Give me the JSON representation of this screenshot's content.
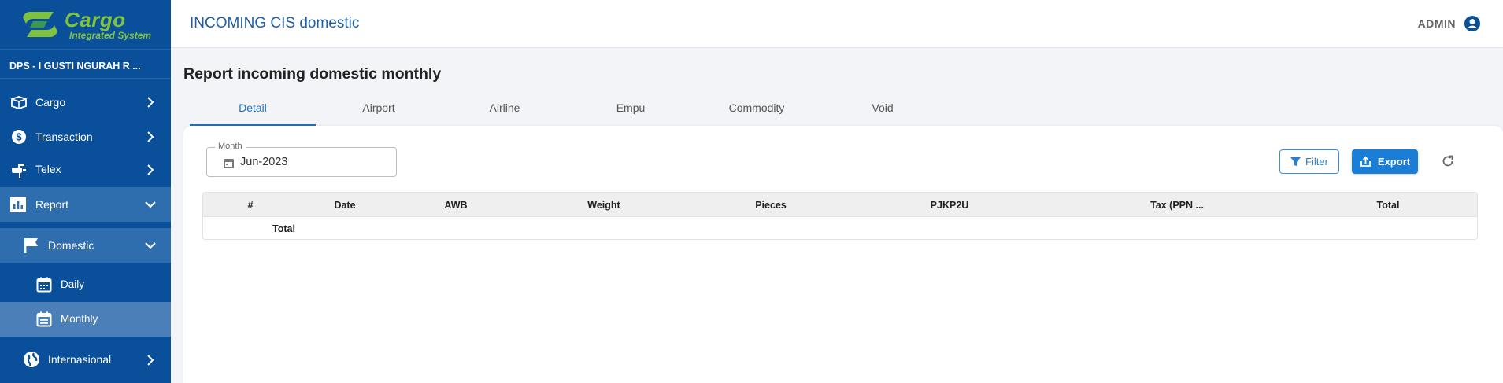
{
  "app": {
    "logo_title": "Cargo",
    "logo_subtitle": "Integrated System",
    "station": "DPS - I GUSTI NGURAH R ...",
    "colors": {
      "sidebar": "#0a4f99",
      "accent": "#1a7ed6",
      "logo_green": "#7fc241"
    }
  },
  "sidebar": {
    "items": [
      {
        "label": "Cargo",
        "icon": "box-icon"
      },
      {
        "label": "Transaction",
        "icon": "dollar-coin-icon"
      },
      {
        "label": "Telex",
        "icon": "mailbox-icon"
      },
      {
        "label": "Report",
        "icon": "bar-chart-icon"
      },
      {
        "label": "Domestic",
        "icon": "flag-icon"
      },
      {
        "label": "Daily",
        "icon": "calendar-icon"
      },
      {
        "label": "Monthly",
        "icon": "calendar-icon"
      },
      {
        "label": "Internasional",
        "icon": "globe-icon"
      }
    ]
  },
  "header": {
    "title": "INCOMING CIS domestic",
    "user": "ADMIN"
  },
  "main": {
    "page_title": "Report incoming domestic monthly",
    "tabs": [
      {
        "label": "Detail",
        "active": true
      },
      {
        "label": "Airport"
      },
      {
        "label": "Airline"
      },
      {
        "label": "Empu"
      },
      {
        "label": "Commodity"
      },
      {
        "label": "Void"
      }
    ],
    "month_field": {
      "label": "Month",
      "value": "Jun-2023"
    },
    "buttons": {
      "filter": "Filter",
      "export": "Export"
    },
    "table": {
      "columns": [
        "#",
        "Date",
        "AWB",
        "Weight",
        "Pieces",
        "PJKP2U",
        "Tax (PPN ...",
        "Total"
      ],
      "footer_label": "Total"
    }
  }
}
